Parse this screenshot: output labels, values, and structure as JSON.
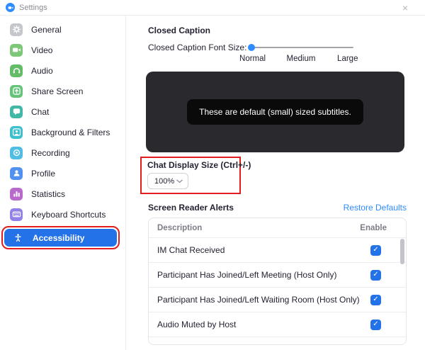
{
  "window": {
    "title": "Settings",
    "close_icon": "×"
  },
  "sidebar": {
    "items": [
      {
        "label": "General",
        "icon": "gear-icon",
        "color": "#c6c6cd"
      },
      {
        "label": "Video",
        "icon": "video-camera-icon",
        "color": "#7dc878"
      },
      {
        "label": "Audio",
        "icon": "headphones-icon",
        "color": "#63bd66"
      },
      {
        "label": "Share Screen",
        "icon": "share-screen-icon",
        "color": "#66c379"
      },
      {
        "label": "Chat",
        "icon": "chat-bubble-icon",
        "color": "#41b7a6"
      },
      {
        "label": "Background & Filters",
        "icon": "background-filters-icon",
        "color": "#3fc0cf"
      },
      {
        "label": "Recording",
        "icon": "record-icon",
        "color": "#4fbde4"
      },
      {
        "label": "Profile",
        "icon": "profile-icon",
        "color": "#5192f0"
      },
      {
        "label": "Statistics",
        "icon": "statistics-icon",
        "color": "#b869cb"
      },
      {
        "label": "Keyboard Shortcuts",
        "icon": "keyboard-icon",
        "color": "#9181e8"
      },
      {
        "label": "Accessibility",
        "icon": "accessibility-icon",
        "color": "#ffffff",
        "selected": true
      }
    ]
  },
  "closed_caption": {
    "section_title": "Closed Caption",
    "font_size_label": "Closed Caption Font Size:",
    "slider_value": "Normal",
    "slider_ticks": [
      "Normal",
      "Medium",
      "Large"
    ],
    "preview_text": "These are default (small) sized subtitles."
  },
  "chat_display": {
    "label": "Chat Display Size (Ctrl+/-)",
    "value": "100%"
  },
  "screen_reader": {
    "section_title": "Screen Reader Alerts",
    "restore_link": "Restore Defaults",
    "table": {
      "columns": [
        "Description",
        "Enable"
      ],
      "rows": [
        {
          "description": "IM Chat Received",
          "enabled": true
        },
        {
          "description": "Participant Has Joined/Left Meeting (Host Only)",
          "enabled": true
        },
        {
          "description": "Participant Has Joined/Left Waiting Room (Host Only)",
          "enabled": true
        },
        {
          "description": "Audio Muted by Host",
          "enabled": true
        }
      ]
    }
  },
  "colors": {
    "accent": "#2472e8",
    "link": "#2d8cff",
    "slider_dot": "#2d8cff",
    "annotation_red": "#e11d1d"
  }
}
